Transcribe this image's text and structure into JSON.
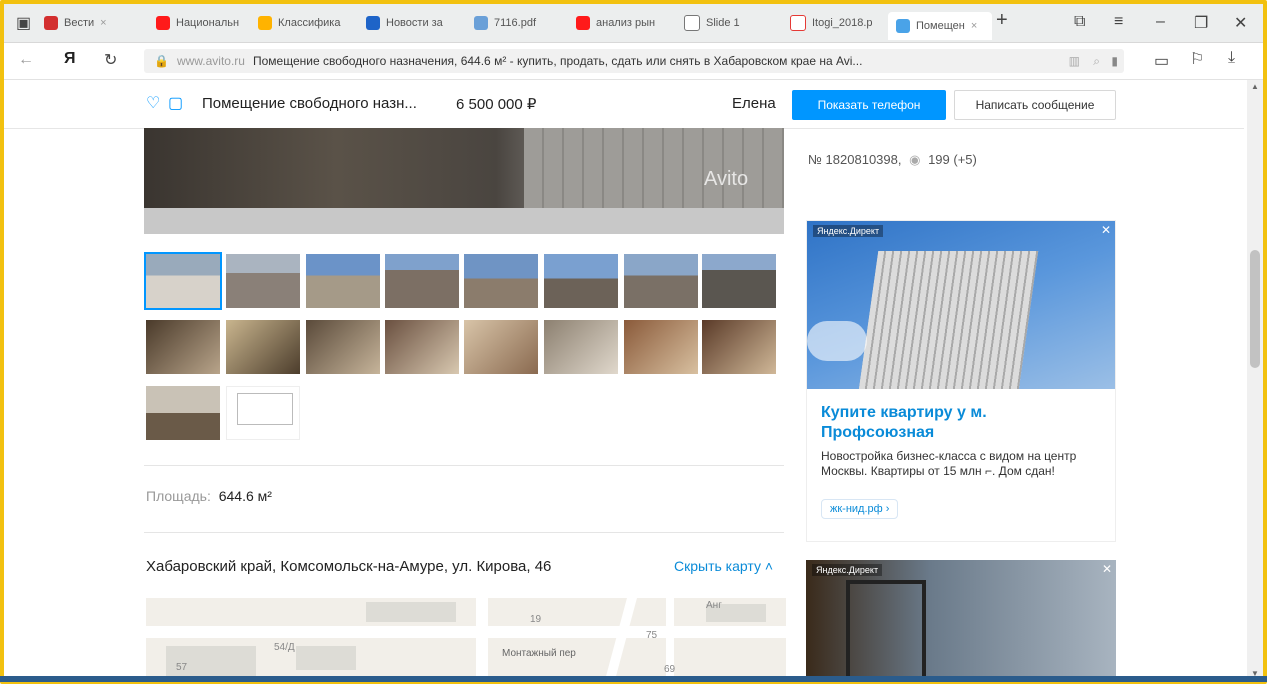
{
  "tabs": [
    {
      "label": "Вести",
      "color": "#d32f2f"
    },
    {
      "label": "Национальн",
      "color": "#ff1a1a"
    },
    {
      "label": "Классифика",
      "color": "#ffb300"
    },
    {
      "label": "Новости за",
      "color": "#1e64c8"
    },
    {
      "label": "7116.pdf",
      "color": "#6aa0d8"
    },
    {
      "label": "анализ рын",
      "color": "#ff1a1a"
    },
    {
      "label": "Slide 1",
      "color": "#777777"
    },
    {
      "label": "Itogi_2018.p",
      "color": "#e53935"
    },
    {
      "label": "Помещен",
      "color": "#4aa3e8",
      "active": true
    }
  ],
  "address": {
    "domain": "www.avito.ru",
    "title": "Помещение свободного назначения, 644.6 м² - купить, продать, сдать или снять в Хабаровском крае на Avi..."
  },
  "sticky": {
    "title": "Помещение свободного назн...",
    "price": "6 500 000 ₽",
    "seller": "Елена",
    "show_phone": "Показать телефон",
    "write_message": "Написать сообщение"
  },
  "photo": {
    "watermark": "Avito"
  },
  "listing": {
    "id_views": "№ 1820810398,",
    "views": "199 (+5)",
    "area_label": "Площадь:",
    "area_value": "644.6 м²",
    "address": "Хабаровский край, Комсомольск-на-Амуре, ул. Кирова, 46",
    "hide_map": "Скрыть карту"
  },
  "map": {
    "labels": [
      "54/Д",
      "57",
      "19",
      "75",
      "69",
      "Монтажный пер",
      "Анг"
    ]
  },
  "ads": {
    "label": "Яндекс.Директ",
    "ad1": {
      "title": "Купите квартиру у м. Профсоюзная",
      "text": "Новостройка бизнес-класса с видом на центр Москвы. Квартиры от 15 млн ⌐. Дом сдан!",
      "link": "жк-нид.рф ›"
    }
  },
  "colors": {
    "frame": "#f2c10f",
    "accent": "#0096ff",
    "link": "#0a8bd8",
    "ad_title": "#0a8bd8"
  }
}
